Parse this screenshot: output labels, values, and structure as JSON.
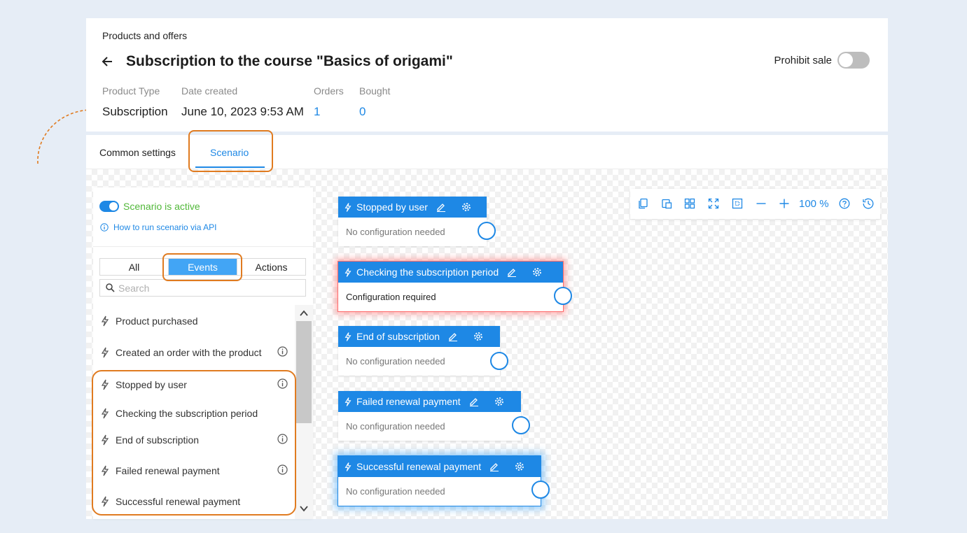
{
  "header": {
    "breadcrumb": "Products and offers",
    "title": "Subscription to the course \"Basics of origami\"",
    "prohibit_sale_label": "Prohibit sale",
    "meta": [
      {
        "label": "Product Type",
        "value": "Subscription"
      },
      {
        "label": "Date created",
        "value": "June 10, 2023 9:53 AM"
      },
      {
        "label": "Orders",
        "value": "1"
      },
      {
        "label": "Bought",
        "value": "0"
      }
    ]
  },
  "tabs": [
    {
      "label": "Common settings"
    },
    {
      "label": "Scenario"
    }
  ],
  "panel": {
    "active_label": "Scenario is active",
    "api_link": "How to run scenario via API",
    "filters": [
      "All",
      "Events",
      "Actions"
    ],
    "search_placeholder": "Search",
    "events": [
      "Product purchased",
      "Created an order with the product",
      "Stopped by user",
      "Checking the subscription period",
      "End of subscription",
      "Failed renewal payment",
      "Successful renewal payment"
    ]
  },
  "nodes": [
    {
      "title": "Stopped by user",
      "body": "No configuration needed"
    },
    {
      "title": "Checking the subscription period",
      "body": "Configuration required"
    },
    {
      "title": "End of subscription",
      "body": "No configuration needed"
    },
    {
      "title": "Failed renewal payment",
      "body": "No configuration needed"
    },
    {
      "title": "Successful renewal payment",
      "body": "No configuration needed"
    }
  ],
  "toolbar": {
    "zoom": "100 %"
  },
  "colors": {
    "accent": "#1e88e5",
    "active_green": "#52b83a",
    "highlight": "#e07b20",
    "error": "#ff6b6b"
  },
  "icons": [
    "back-arrow-icon",
    "bolt-icon",
    "pencil-icon",
    "gear-icon",
    "info-icon",
    "search-icon",
    "copy-icon",
    "paste-icon",
    "grid-icon",
    "fit-icon",
    "select-icon",
    "zoom-out-icon",
    "zoom-in-icon",
    "help-icon",
    "history-icon"
  ]
}
